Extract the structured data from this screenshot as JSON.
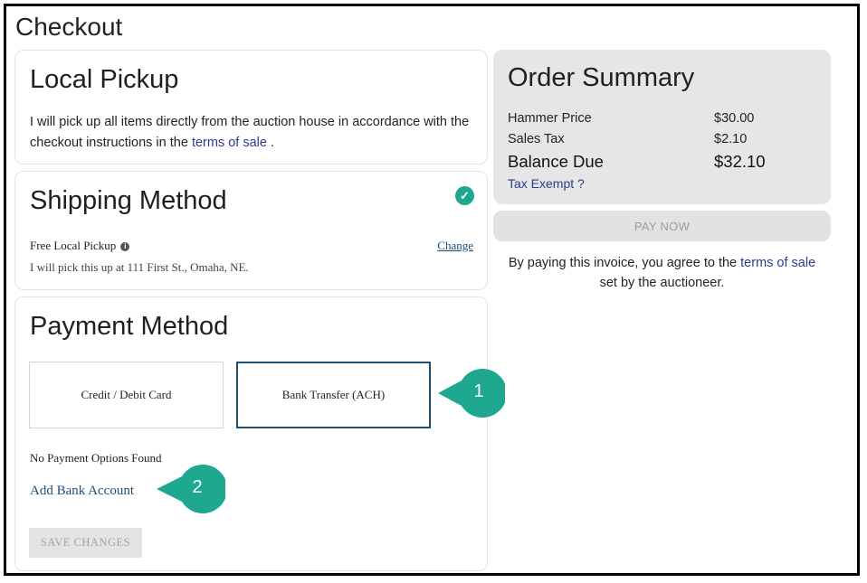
{
  "page": {
    "title": "Checkout"
  },
  "pickup": {
    "heading": "Local Pickup",
    "text_before": "I will pick up all items directly from the auction house in accordance with the checkout instructions in the ",
    "link": "terms of sale",
    "text_after": " ."
  },
  "shipping": {
    "heading": "Shipping Method",
    "method": "Free Local Pickup",
    "address": "I will pick this up at 111 First St., Omaha, NE.",
    "change_label": "Change",
    "check_icon": "check-circle-icon",
    "info_icon": "info-icon"
  },
  "payment": {
    "heading": "Payment Method",
    "options": [
      {
        "label": "Credit / Debit Card"
      },
      {
        "label": "Bank Transfer (ACH)",
        "selected": true
      }
    ],
    "no_options": "No Payment Options Found",
    "add_bank": "Add Bank Account",
    "save_label": "SAVE CHANGES"
  },
  "summary": {
    "heading": "Order Summary",
    "rows": [
      {
        "label": "Hammer Price",
        "value": "$30.00"
      },
      {
        "label": "Sales Tax",
        "value": "$2.10"
      },
      {
        "label": "Balance Due",
        "value": "$32.10"
      }
    ],
    "tax_exempt": "Tax Exempt ?"
  },
  "pay_now": {
    "label": "PAY NOW"
  },
  "agreement": {
    "text_before": "By paying this invoice, you agree to the ",
    "link": "terms of sale",
    "text_after": " set by the auctioneer."
  },
  "callouts": [
    {
      "number": "1"
    },
    {
      "number": "2"
    }
  ],
  "colors": {
    "callout": "#1ea890",
    "selected_border": "#1e4d6e",
    "link": "#2e3a8c",
    "check": "#1ea890"
  }
}
